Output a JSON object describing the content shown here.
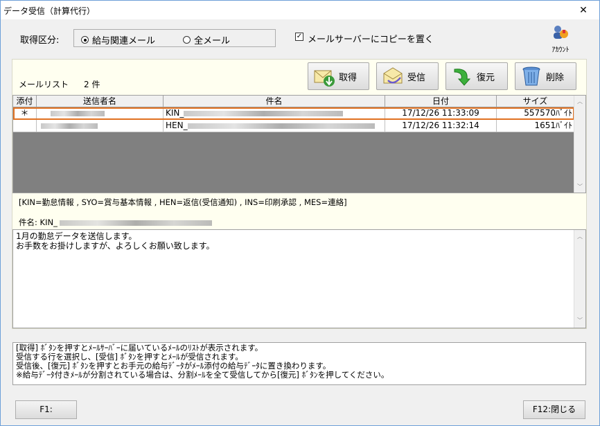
{
  "window": {
    "title": "データ受信（計算代行）",
    "close_glyph": "✕"
  },
  "filter": {
    "label": "取得区分:",
    "options": [
      {
        "label": "給与関連メール",
        "selected": true
      },
      {
        "label": "全メール",
        "selected": false
      }
    ]
  },
  "copy_option": {
    "label": "メールサーバーにコピーを置く",
    "checked": true,
    "check_glyph": "✓"
  },
  "account": {
    "label": "ｱｶｳﾝﾄ",
    "icon": "account-icon"
  },
  "mail_list": {
    "label": "メールリスト",
    "count": "2 件"
  },
  "toolbar": {
    "fetch_label": "取得",
    "receive_label": "受信",
    "restore_label": "復元",
    "delete_label": "削除"
  },
  "table": {
    "headers": [
      "添付",
      "送信者名",
      "件名",
      "日付",
      "サイズ"
    ],
    "rows": [
      {
        "attach": "＊",
        "subject": "KIN_",
        "date": "17/12/26 11:33:09",
        "size": "557570ﾊﾞｲﾄ",
        "selected": true
      },
      {
        "attach": "",
        "subject": "HEN_",
        "date": "17/12/26 11:32:14",
        "size": "1651ﾊﾞｲﾄ",
        "selected": false
      }
    ]
  },
  "legend": "[KIN=勤怠情報 , SYO=賞与基本情報 , HEN=返信(受信通知) , INS=印刷承認 , MES=連絡]",
  "subject_line": {
    "label": "件名: KIN_"
  },
  "body": {
    "line1": "1月の勤怠データを送信します。",
    "line2": "お手数をお掛けしますが、よろしくお願い致します。"
  },
  "info": {
    "line1": "[取得] ﾎﾞﾀﾝを押すとﾒｰﾙｻｰﾊﾞｰに届いているﾒｰﾙのﾘｽﾄが表示されます。",
    "line2": "受信する行を選択し、[受信] ﾎﾞﾀﾝを押すとﾒｰﾙが受信されます。",
    "line3": "受信後、[復元] ﾎﾞﾀﾝを押すとお手元の給与ﾃﾞｰﾀがﾒｰﾙ添付の給与ﾃﾞｰﾀに置き換わります。",
    "line4": "※給与ﾃﾞｰﾀ付きﾒｰﾙが分割されている場合は、分割ﾒｰﾙを全て受信してから[復元] ﾎﾞﾀﾝを押してください。"
  },
  "footer": {
    "f1_label": "F1:",
    "f12_label": "F12:閉じる"
  },
  "colors": {
    "selection_border": "#e07020",
    "grid_empty": "#808080",
    "panel_bg": "#fffff0"
  }
}
